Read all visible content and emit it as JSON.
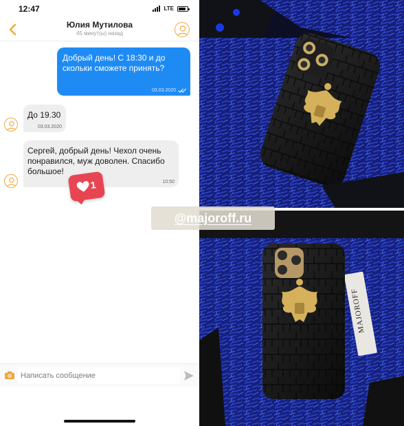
{
  "status_bar": {
    "time": "12:47",
    "network": "LTE",
    "battery_percent": 80
  },
  "chat": {
    "contact_name": "Юлия Мутилова",
    "last_seen": "45 минут(ы) назад",
    "messages": [
      {
        "direction": "out",
        "text": "Добрый день! С 18:30 и до скольки сможете принять?",
        "time": "03.03.2020"
      },
      {
        "direction": "in",
        "text": "До 19.30",
        "time": "03.03.2020"
      },
      {
        "direction": "in",
        "text": "Сергей, добрый день! Чехол очень понравился, муж доволен. Спасибо большое!",
        "time": "10:50"
      }
    ],
    "like_count": "1",
    "composer_placeholder": "Написать сообщение"
  },
  "overlay": {
    "handle": "@majoroff.ru"
  },
  "product": {
    "box_label": "MAJOROFF"
  },
  "colors": {
    "accent": "#f0a83a",
    "outgoing_bubble": "#1e8bf5",
    "like_badge": "#e84552",
    "case": "#121212",
    "gold": "#d4b15a",
    "packaging": "#1a2a9a"
  }
}
